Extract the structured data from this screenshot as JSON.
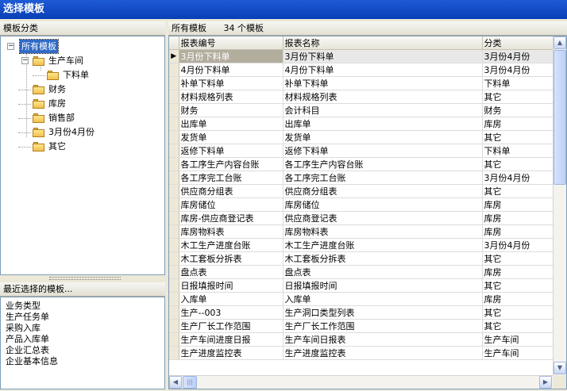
{
  "window": {
    "title": "选择模板"
  },
  "left_panel": {
    "header": "模板分类",
    "tree": [
      {
        "label": "所有模板",
        "level": 0,
        "expander": "−",
        "selected": true,
        "folder": false
      },
      {
        "label": "生产车间",
        "level": 1,
        "expander": "−",
        "selected": false,
        "folder": true
      },
      {
        "label": "下料单",
        "level": 2,
        "expander": "",
        "selected": false,
        "folder": true
      },
      {
        "label": "财务",
        "level": 1,
        "expander": "",
        "selected": false,
        "folder": true
      },
      {
        "label": "库房",
        "level": 1,
        "expander": "",
        "selected": false,
        "folder": true
      },
      {
        "label": "销售部",
        "level": 1,
        "expander": "",
        "selected": false,
        "folder": true
      },
      {
        "label": "3月份4月份",
        "level": 1,
        "expander": "",
        "selected": false,
        "folder": true
      },
      {
        "label": "其它",
        "level": 1,
        "expander": "",
        "selected": false,
        "folder": true
      }
    ],
    "recent_header": "最近选择的模板...",
    "recent_items": [
      "业务类型",
      "生产任务单",
      "采购入库",
      "产品入库单",
      "企业汇总表",
      "企业基本信息"
    ]
  },
  "right_panel": {
    "header_label": "所有模板",
    "count_text": "34 个模板",
    "columns": [
      "报表编号",
      "报表名称",
      "分类"
    ],
    "rows": [
      [
        "3月份下料单",
        "3月份下料单",
        "3月份4月份"
      ],
      [
        "4月份下料单",
        "4月份下料单",
        "3月份4月份"
      ],
      [
        "补单下料单",
        "补单下料单",
        "下料单"
      ],
      [
        "材料规格列表",
        "材料规格列表",
        "其它"
      ],
      [
        "财务",
        "会计科目",
        "财务"
      ],
      [
        "出库单",
        "出库单",
        "库房"
      ],
      [
        "发货单",
        "发货单",
        "其它"
      ],
      [
        "返修下料单",
        "返修下料单",
        "下料单"
      ],
      [
        "各工序生产内容台账",
        "各工序生产内容台账",
        "其它"
      ],
      [
        "各工序完工台账",
        "各工序完工台账",
        "3月份4月份"
      ],
      [
        "供应商分组表",
        "供应商分组表",
        "其它"
      ],
      [
        "库房储位",
        "库房储位",
        "库房"
      ],
      [
        "库房-供应商登记表",
        "供应商登记表",
        "库房"
      ],
      [
        "库房物料表",
        "库房物料表",
        "库房"
      ],
      [
        "木工生产进度台账",
        "木工生产进度台账",
        "3月份4月份"
      ],
      [
        "木工套板分拆表",
        "木工套板分拆表",
        "其它"
      ],
      [
        "盘点表",
        "盘点表",
        "库房"
      ],
      [
        "日报填报时间",
        "日报填报时间",
        "其它"
      ],
      [
        "入库单",
        "入库单",
        "库房"
      ],
      [
        "生产--003",
        "生产洞口类型列表",
        "其它"
      ],
      [
        "生产厂长工作范围",
        "生产厂长工作范围",
        "其它"
      ],
      [
        "生产车间进度日报",
        "生产车间日报表",
        "生产车间"
      ],
      [
        "生产进度监控表",
        "生产进度监控表",
        "生产车间"
      ]
    ],
    "selected_row": 0,
    "row_indicator": "▶"
  },
  "scrollbar": {
    "up": "▲",
    "down": "▼",
    "left": "◀",
    "right": "▶",
    "grip": "|||"
  }
}
